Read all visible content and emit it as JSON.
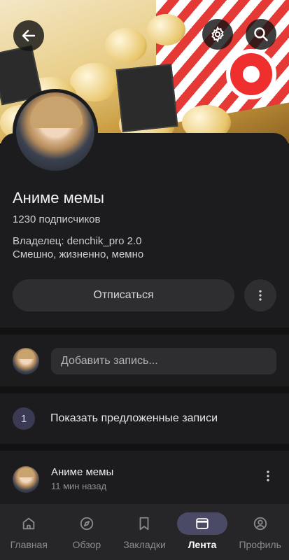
{
  "header": {
    "back_icon": "arrow-left-icon",
    "settings_icon": "gear-icon",
    "search_icon": "search-icon"
  },
  "community": {
    "name": "Аниме мемы",
    "subscribers": "1230 подписчиков",
    "owner": "Владелец: denchik_pro 2.0",
    "description": "Смешно, жизненно, мемно",
    "unsubscribe_label": "Отписаться"
  },
  "composer": {
    "placeholder": "Добавить запись..."
  },
  "suggested": {
    "count": "1",
    "label": "Показать предложенные записи"
  },
  "post": {
    "author": "Аниме мемы",
    "time": "11 мин назад"
  },
  "nav": {
    "items": [
      {
        "label": "Главная",
        "icon": "home-icon"
      },
      {
        "label": "Обзор",
        "icon": "compass-icon"
      },
      {
        "label": "Закладки",
        "icon": "bookmark-icon"
      },
      {
        "label": "Лента",
        "icon": "feed-icon",
        "active": true
      },
      {
        "label": "Профиль",
        "icon": "profile-icon"
      }
    ]
  },
  "colors": {
    "background": "#1c1c1e",
    "accent": "#4a4a66",
    "cover_red": "#e53935"
  }
}
